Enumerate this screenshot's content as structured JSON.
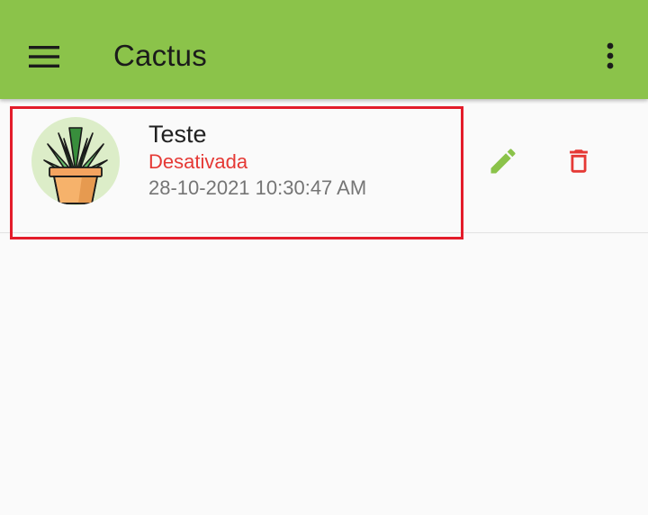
{
  "appbar": {
    "title": "Cactus",
    "menu_icon": "menu-icon",
    "more_icon": "more-vert-icon",
    "background_color": "#8bc34a"
  },
  "list": {
    "items": [
      {
        "name": "Teste",
        "status": "Desativada",
        "date": "28-10-2021 10:30:47 AM",
        "avatar_icon": "potted-plant-icon",
        "edit_icon": "pencil-icon",
        "delete_icon": "trash-icon"
      }
    ]
  },
  "colors": {
    "status_inactive": "#e53935",
    "edit_accent": "#8bc34a",
    "delete_accent": "#e53935",
    "highlight": "#e31c2a"
  }
}
